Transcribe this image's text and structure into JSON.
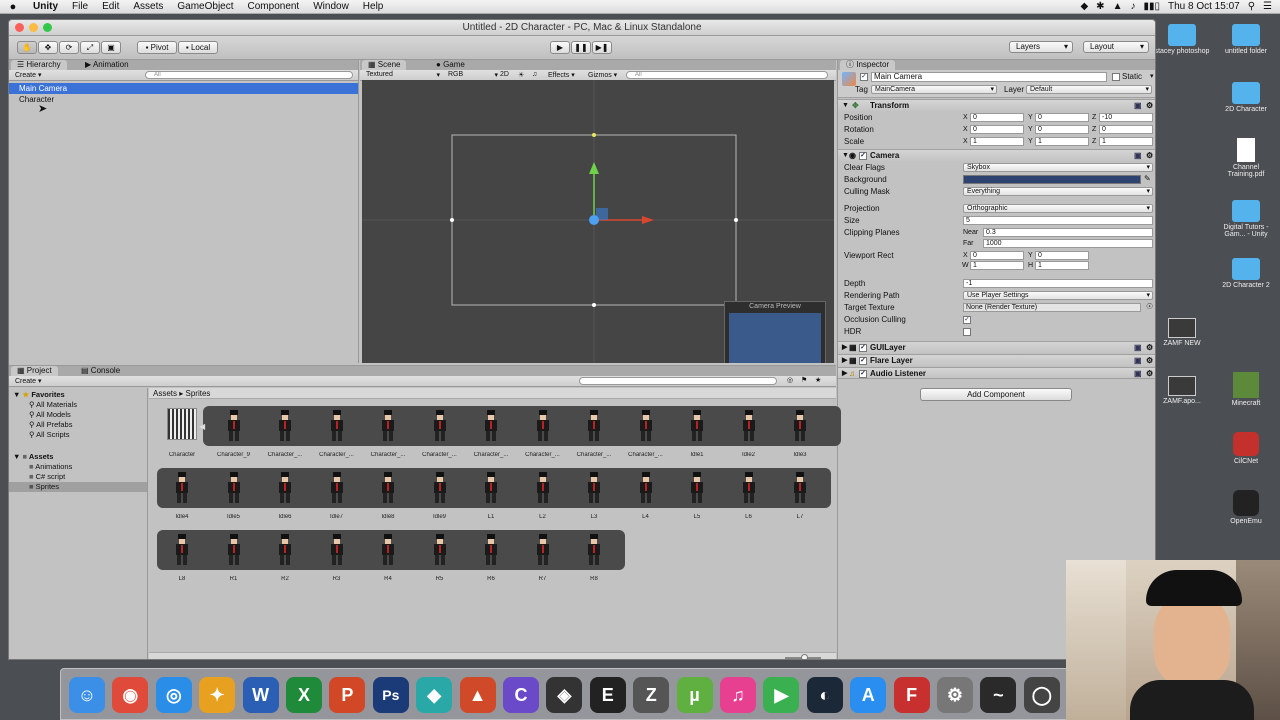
{
  "menubar": {
    "app_name": "Unity",
    "items": [
      "File",
      "Edit",
      "Assets",
      "GameObject",
      "Component",
      "Window",
      "Help"
    ],
    "clock": "Thu 8 Oct  15:07"
  },
  "window": {
    "title": "Untitled - 2D Character - PC, Mac & Linux Standalone"
  },
  "toolbar": {
    "pivot_label": "Pivot",
    "local_label": "Local",
    "layers_label": "Layers",
    "layout_label": "Layout"
  },
  "hierarchy": {
    "tab_label": "Hierarchy",
    "anim_tab_label": "Animation",
    "create_label": "Create",
    "search_placeholder": "All",
    "items": [
      "Main Camera",
      "Character"
    ]
  },
  "scene": {
    "scene_tab": "Scene",
    "game_tab": "Game",
    "shading": "Textured",
    "rgb": "RGB",
    "mode_2d": "2D",
    "effects": "Effects",
    "gizmos": "Gizmos",
    "search_placeholder": "All",
    "camera_preview_label": "Camera Preview"
  },
  "inspector": {
    "tab_label": "Inspector",
    "object_name": "Main Camera",
    "static_label": "Static",
    "tag_label": "Tag",
    "tag_value": "MainCamera",
    "layer_label": "Layer",
    "layer_value": "Default",
    "transform": {
      "title": "Transform",
      "position_label": "Position",
      "rotation_label": "Rotation",
      "scale_label": "Scale",
      "position": [
        "0",
        "0",
        "-10"
      ],
      "rotation": [
        "0",
        "0",
        "0"
      ],
      "scale": [
        "1",
        "1",
        "1"
      ]
    },
    "camera": {
      "title": "Camera",
      "clear_flags_label": "Clear Flags",
      "clear_flags": "Skybox",
      "background_label": "Background",
      "background_color": "#2f4370",
      "culling_mask_label": "Culling Mask",
      "culling_mask": "Everything",
      "projection_label": "Projection",
      "projection": "Orthographic",
      "size_label": "Size",
      "size": "5",
      "clipping_label": "Clipping Planes",
      "near_label": "Near",
      "near": "0.3",
      "far_label": "Far",
      "far": "1000",
      "viewport_label": "Viewport Rect",
      "viewport_x": "0",
      "viewport_y": "0",
      "viewport_w": "1",
      "viewport_h": "1",
      "depth_label": "Depth",
      "depth": "-1",
      "rendering_path_label": "Rendering Path",
      "rendering_path": "Use Player Settings",
      "target_texture_label": "Target Texture",
      "target_texture": "None (Render Texture)",
      "occlusion_label": "Occlusion Culling",
      "hdr_label": "HDR"
    },
    "components": [
      "GUILayer",
      "Flare Layer",
      "Audio Listener"
    ],
    "add_component_label": "Add Component"
  },
  "project": {
    "tab_label": "Project",
    "console_tab_label": "Console",
    "create_label": "Create",
    "favorites_label": "Favorites",
    "favorites": [
      "All Materials",
      "All Models",
      "All Prefabs",
      "All Scripts"
    ],
    "assets_label": "Assets",
    "asset_folders": [
      "Animations",
      "C# script",
      "Sprites"
    ],
    "breadcrumb": [
      "Assets",
      "Sprites"
    ],
    "sprite_rows": [
      [
        "Character",
        "Character_9",
        "Character_...",
        "Character_...",
        "Character_...",
        "Character_...",
        "Character_...",
        "Character_...",
        "Character_...",
        "Character_...",
        "Idle1",
        "Idle2",
        "Idle3"
      ],
      [
        "Idle4",
        "Idle5",
        "Idle6",
        "Idle7",
        "Idle8",
        "Idle9",
        "L1",
        "L2",
        "L3",
        "L4",
        "L5",
        "L6",
        "L7"
      ],
      [
        "L8",
        "R1",
        "R2",
        "R3",
        "R4",
        "R5",
        "R6",
        "R7",
        "R8"
      ]
    ]
  },
  "desktop": {
    "icons": [
      {
        "label": "stacey photoshop",
        "kind": "folder"
      },
      {
        "label": "untitled folder",
        "kind": "folder"
      },
      {
        "label": "2D Character",
        "kind": "folder"
      },
      {
        "label": "Channel Training.pdf",
        "kind": "file"
      },
      {
        "label": "Digital Tutors - Gam... - Unity",
        "kind": "folder"
      },
      {
        "label": "2D Character 2",
        "kind": "folder"
      },
      {
        "label": "ZAMF NEW",
        "kind": "image"
      },
      {
        "label": "ZAMF.apo...",
        "kind": "image"
      },
      {
        "label": "Minecraft",
        "kind": "app"
      },
      {
        "label": "CilCNet",
        "kind": "app"
      },
      {
        "label": "OpenEmu",
        "kind": "app"
      }
    ]
  },
  "dock": {
    "apps": [
      "finder-icon",
      "chrome-icon",
      "safari-icon",
      "blender-icon",
      "word-icon",
      "excel-icon",
      "powerpoint-icon",
      "photoshop-icon",
      "maya-icon",
      "mudbox-icon",
      "codec-icon",
      "unity-icon",
      "epic-games-icon",
      "zbrush-icon",
      "utorrent-icon",
      "itunes-icon",
      "facetime-icon",
      "steam-icon",
      "app-store-icon",
      "filezilla-icon",
      "system-preferences-icon",
      "activity-monitor-icon",
      "obs-icon"
    ]
  }
}
